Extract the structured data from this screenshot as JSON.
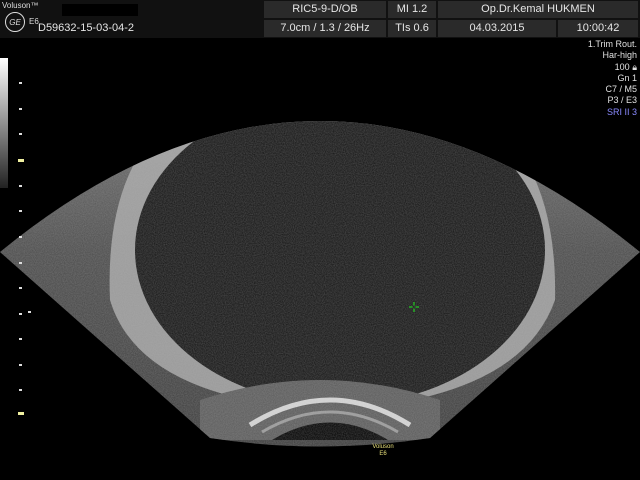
{
  "header": {
    "brand_name": "Voluson™",
    "brand_model": "E6",
    "logo_text": "GE",
    "patient_id": "D59632-15-03-04-2",
    "probe": "RIC5-9-D/OB",
    "depth_info": "7.0cm / 1.3 / 26Hz",
    "mi": "MI  1.2",
    "tis": "TIs  0.6",
    "operator": "Op.Dr.Kemal HUKMEN",
    "date": "04.03.2015",
    "time": "10:00:42"
  },
  "params": {
    "preset": "1.Trim Rout.",
    "harmonic": "Har-high",
    "power": "100",
    "gain": "Gn  1",
    "c_m": "C7 / M5",
    "p_e": "P3 / E3",
    "sri": "SRI II 3"
  },
  "footer": {
    "brand_line1": "Voluson",
    "brand_line2": "E6"
  },
  "colors": {
    "cursor": "#22cc22",
    "highlight": "#8a8aff",
    "brand_text": "#e8e07a"
  }
}
